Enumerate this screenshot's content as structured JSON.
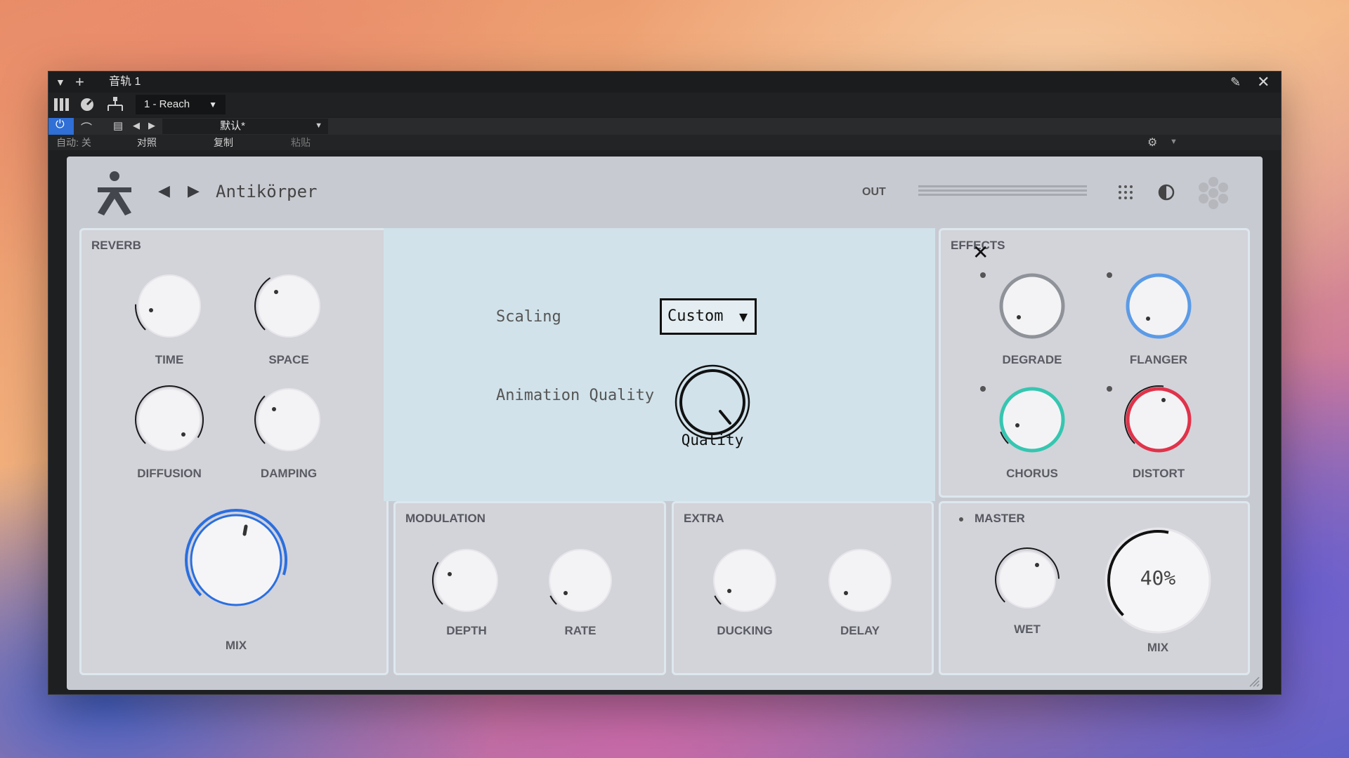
{
  "host": {
    "track_title": "音轨 1",
    "preset_slot": "1 - Reach",
    "preset_name": "默认*",
    "auto_label": "自动: 关",
    "compare_label": "对照",
    "copy_label": "复制",
    "paste_label": "粘贴"
  },
  "plugin": {
    "name": "Antikörper",
    "out_label": "OUT",
    "reverb": {
      "title": "REVERB",
      "knobs": [
        "TIME",
        "SPACE",
        "DIFFUSION",
        "DAMPING"
      ],
      "mix_label": "MIX"
    },
    "modulation": {
      "title": "MODULATION",
      "knobs": [
        "DEPTH",
        "RATE"
      ]
    },
    "extra": {
      "title": "EXTRA",
      "knobs": [
        "DUCKING",
        "DELAY"
      ]
    },
    "effects": {
      "title": "EFFECTS",
      "knobs": [
        "DEGRADE",
        "FLANGER",
        "CHORUS",
        "DISTORT"
      ]
    },
    "master": {
      "title": "MASTER",
      "wet_label": "WET",
      "mix_label": "MIX",
      "mix_value": "40%"
    },
    "settings": {
      "scaling_label": "Scaling",
      "scaling_value": "Custom",
      "animation_label": "Animation Quality",
      "quality_label": "Quality"
    }
  },
  "colors": {
    "mix_accent": "#2a6fe0",
    "degrade": "#8f9399",
    "flanger": "#5b9be6",
    "chorus": "#35c6b0",
    "distort": "#e0334a"
  }
}
